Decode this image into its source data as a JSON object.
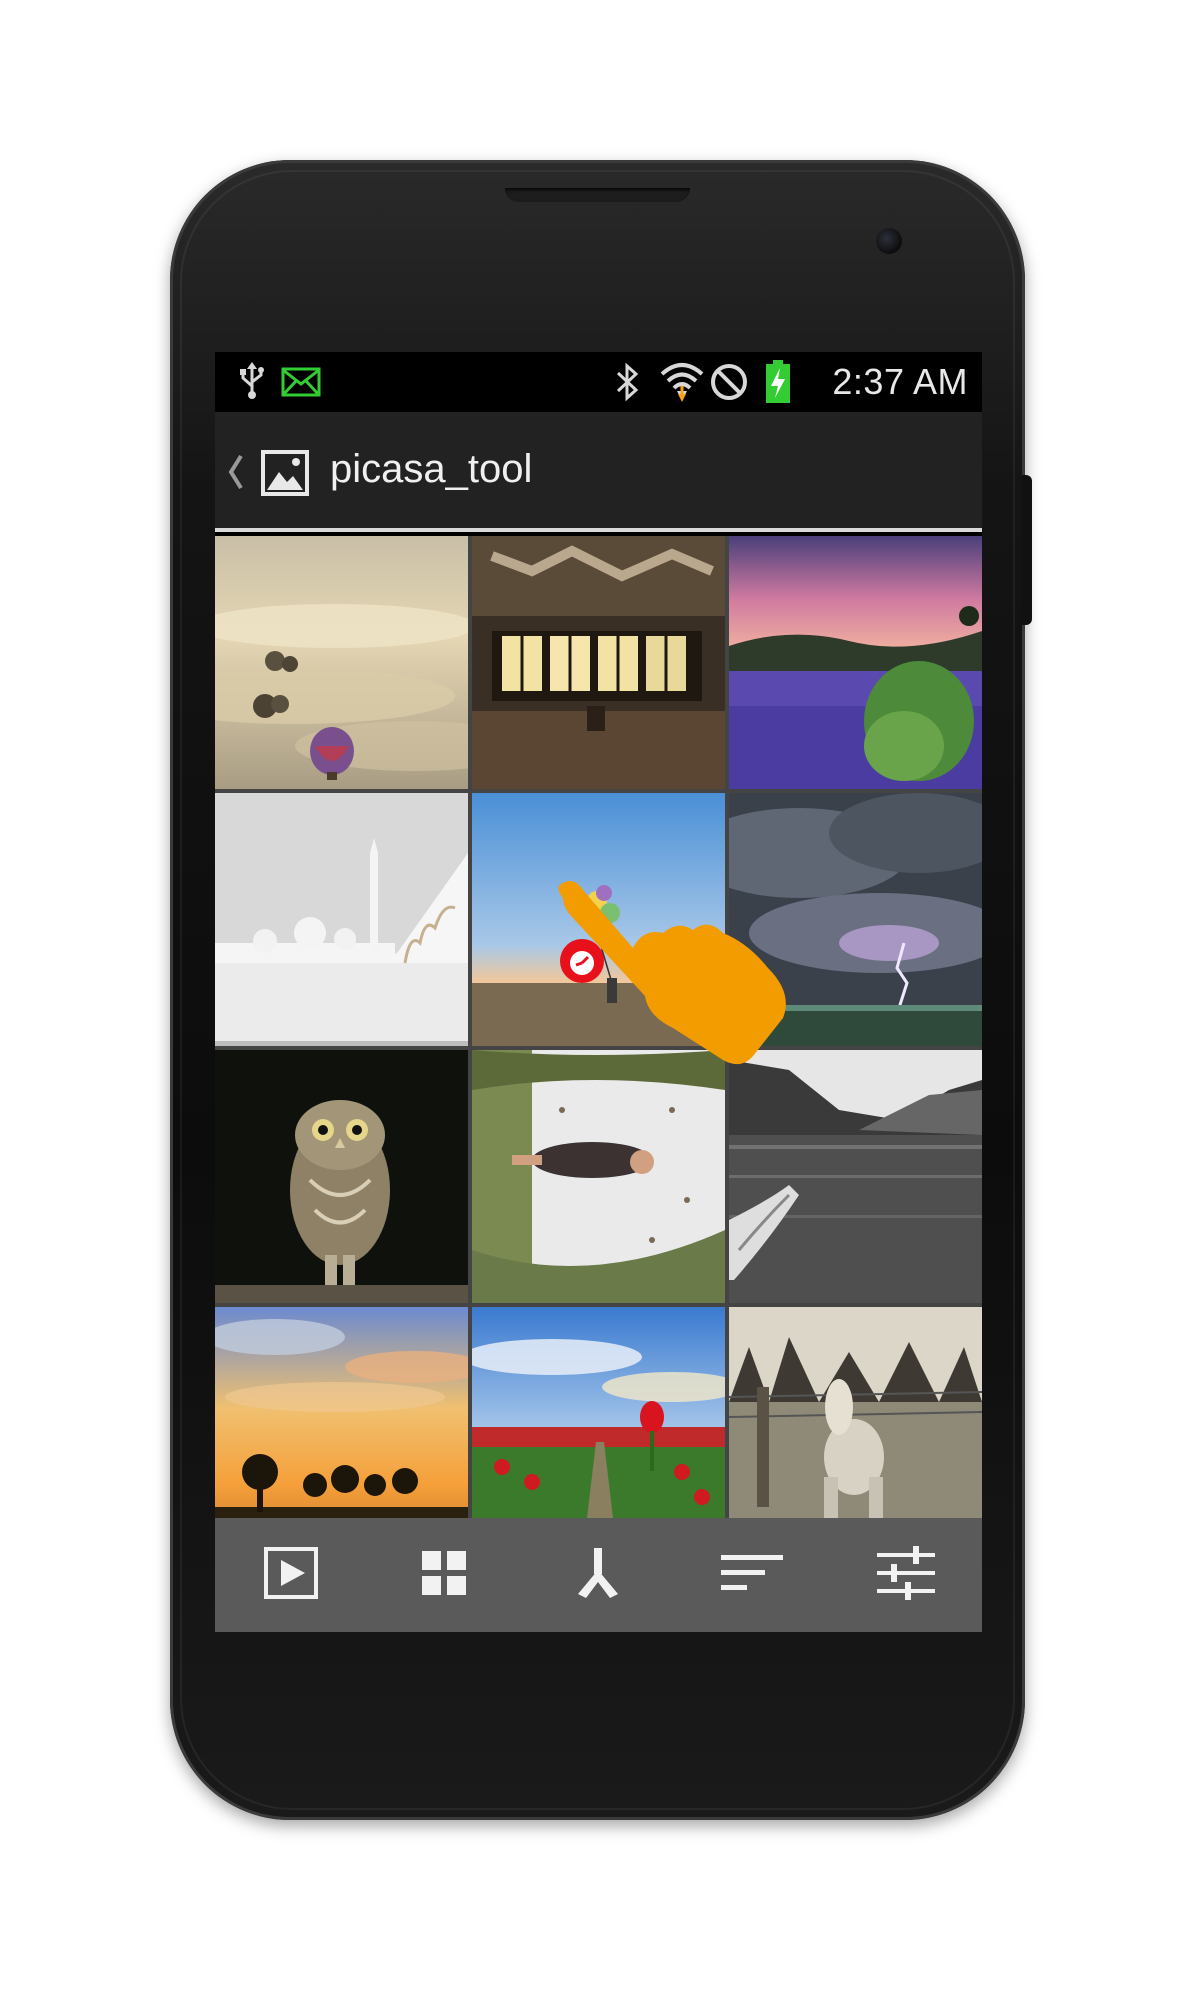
{
  "status_bar": {
    "time": "2:37 AM",
    "icons": [
      "usb-icon",
      "email-icon",
      "bluetooth-icon",
      "wifi-icon",
      "blocked-icon",
      "battery-charging-icon"
    ]
  },
  "action_bar": {
    "title": "picasa_tool",
    "icons": [
      "up-chevron-icon",
      "gallery-app-icon"
    ]
  },
  "photos": [
    {
      "label": "hot-air-balloon-over-clouds"
    },
    {
      "label": "abandoned-room-windows"
    },
    {
      "label": "lavender-field-sunset"
    },
    {
      "label": "white-mosque"
    },
    {
      "label": "girl-with-balloons-beach"
    },
    {
      "label": "storm-lightning"
    },
    {
      "label": "owl-on-dark"
    },
    {
      "label": "woman-upside-down-forest"
    },
    {
      "label": "canoe-on-lake"
    },
    {
      "label": "sunset-trees"
    },
    {
      "label": "tulip-field"
    },
    {
      "label": "horse-in-pasture"
    }
  ],
  "bottom_bar": {
    "buttons": [
      "slideshow-icon",
      "grid-view-icon",
      "merge-icon",
      "sort-icon",
      "settings-sliders-icon"
    ]
  },
  "colors": {
    "action_bar_bg": "#222222",
    "bottom_bar_bg": "#5a5a5a",
    "status_icon_green": "#33cc33",
    "wifi_arrow_orange": "#f7a21b",
    "pointer_hand": "#f39c00",
    "timer_red": "#e8101a"
  }
}
